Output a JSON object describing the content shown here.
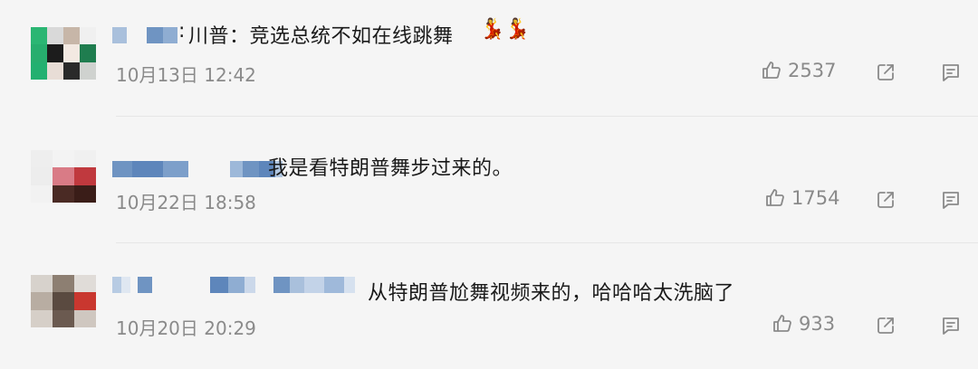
{
  "comments": [
    {
      "text": "川普：竞选总统不如在线跳舞",
      "name_tail": ":",
      "emoji": "💃💃",
      "time": "10月13日 12:42",
      "likes": "2537",
      "icons": [
        "thumbs-up-icon",
        "share-icon",
        "comment-icon"
      ]
    },
    {
      "text": "我是看特朗普舞步过来的。",
      "time": "10月22日 18:58",
      "likes": "1754",
      "icons": [
        "thumbs-up-icon",
        "share-icon",
        "comment-icon"
      ]
    },
    {
      "text": "从特朗普尬舞视频来的，哈哈哈太洗脑了",
      "time": "10月20日 20:29",
      "likes": "933",
      "icons": [
        "thumbs-up-icon",
        "share-icon",
        "comment-icon"
      ]
    }
  ],
  "colors": {
    "background": "#f5f5f5",
    "text": "#1a1a1a",
    "meta": "#8a8a8a",
    "divider": "#e6e6e6",
    "redacted_blue": "#6f94c2"
  }
}
